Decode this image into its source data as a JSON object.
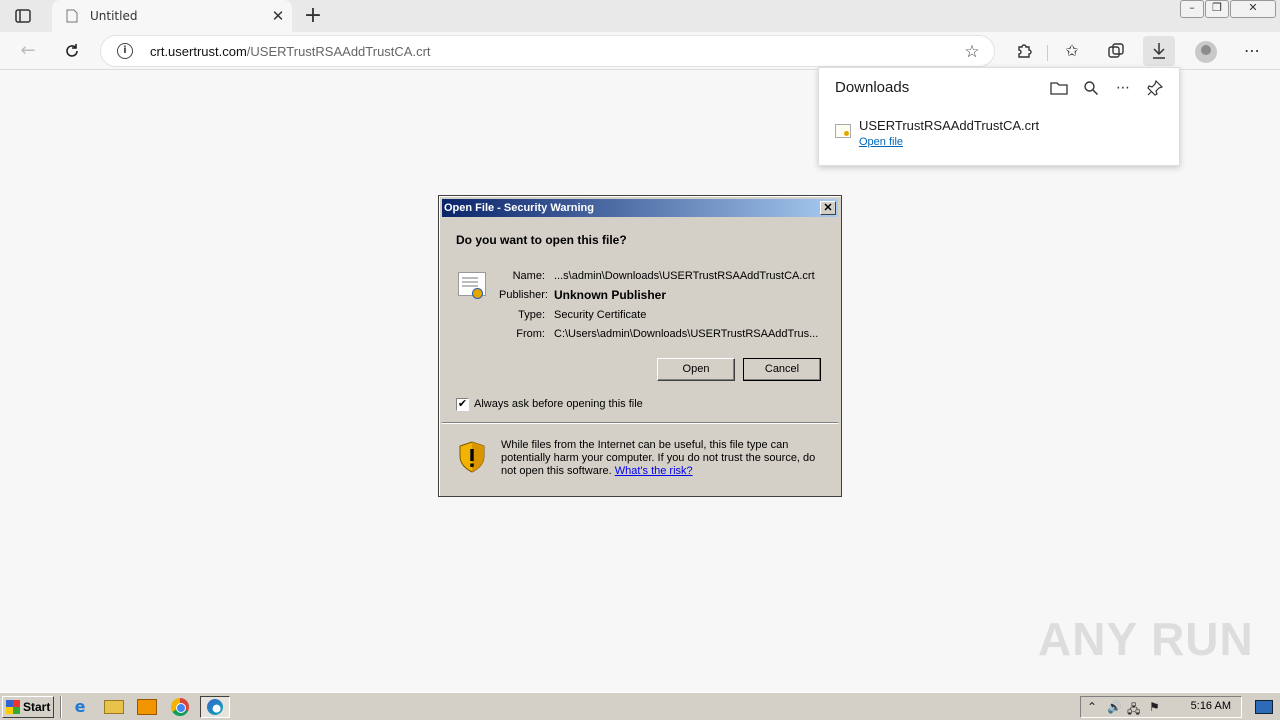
{
  "browser": {
    "tab_title": "Untitled",
    "url_host": "crt.usertrust.com",
    "url_path": "/USERTrustRSAAddTrustCA.crt"
  },
  "downloads": {
    "title": "Downloads",
    "file_name": "USERTrustRSAAddTrustCA.crt",
    "open_file_label": "Open file"
  },
  "dialog": {
    "title": "Open File - Security Warning",
    "question": "Do you want to open this file?",
    "name_label": "Name:",
    "name_value": "...s\\admin\\Downloads\\USERTrustRSAAddTrustCA.crt",
    "publisher_label": "Publisher:",
    "publisher_value": "Unknown Publisher",
    "type_label": "Type:",
    "type_value": "Security Certificate",
    "from_label": "From:",
    "from_value": "C:\\Users\\admin\\Downloads\\USERTrustRSAAddTrus...",
    "open_button": "Open",
    "cancel_button": "Cancel",
    "checkbox_label": "Always ask before opening this file",
    "checkbox_checked": true,
    "warning_text": "While files from the Internet can be useful, this file type can potentially harm your computer. If you do not trust the source, do not open this software. ",
    "risk_link": "What's the risk?"
  },
  "watermark": "ANY RUN",
  "taskbar": {
    "start_label": "Start",
    "clock": "5:16 AM"
  }
}
